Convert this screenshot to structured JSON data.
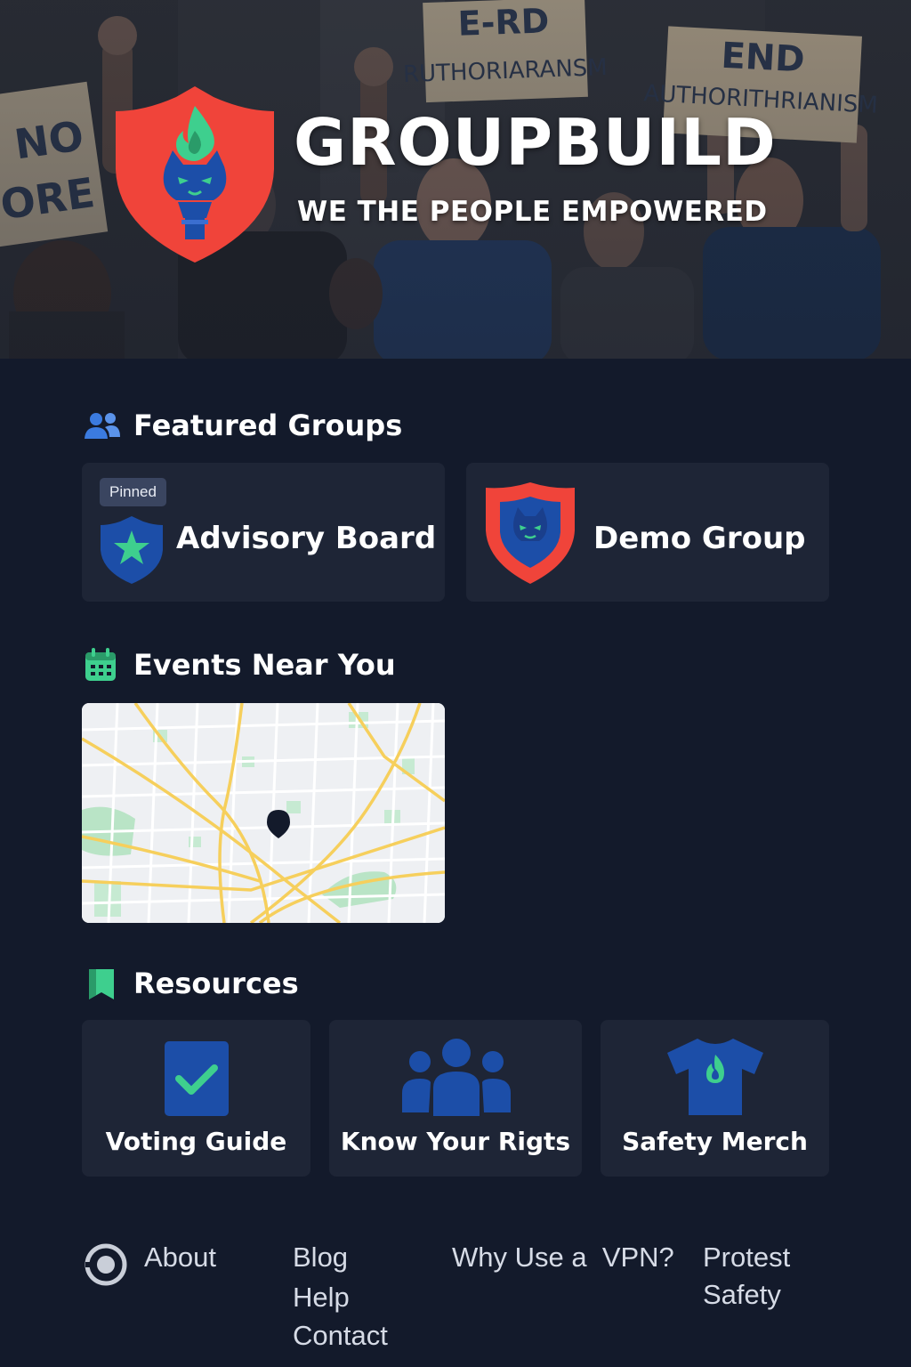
{
  "hero": {
    "brand_title": "GROUPBUILD",
    "tagline": "WE THE PEOPLE EMPOWERED",
    "signs": [
      "END AUTHORITARIANISM",
      "RUTHORIARANSM",
      "NO MORE",
      "END"
    ],
    "logo_icon": "torch-shield-logo-icon"
  },
  "featured_groups": {
    "heading": "Featured Groups",
    "icon": "users-icon",
    "groups": [
      {
        "name": "Advisory Board",
        "badge": "Pinned",
        "icon": "star-shield-icon"
      },
      {
        "name": "Demo Group",
        "badge": "",
        "icon": "cat-shield-icon"
      }
    ]
  },
  "events": {
    "heading": "Events Near You",
    "icon": "calendar-icon",
    "map_pin_icon": "map-pin-icon"
  },
  "resources": {
    "heading": "Resources",
    "icon": "bookmark-icon",
    "items": [
      {
        "label": "Voting Guide",
        "icon": "checkbox-icon"
      },
      {
        "label": "Know Your Rigts",
        "icon": "people-icon"
      },
      {
        "label": "Safety Merch",
        "icon": "tshirt-icon"
      }
    ]
  },
  "footer": {
    "logo_icon": "circle-logo-icon",
    "links": [
      "About",
      "Blog",
      "Help",
      "Contact",
      "Why Use a  VPN?",
      "Protest",
      "Safety"
    ]
  },
  "colors": {
    "background": "#131a2b",
    "card": "#1e2536",
    "shield_red": "#f0443a",
    "brand_blue": "#1c4ea8",
    "accent_green": "#3ecf8e"
  }
}
